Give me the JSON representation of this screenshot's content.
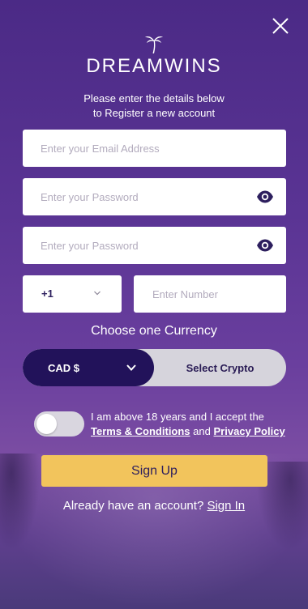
{
  "brand": {
    "logo_text": "DREAMWINS"
  },
  "intro": {
    "line1": "Please enter the details below",
    "line2": "to Register a new account"
  },
  "form": {
    "email_placeholder": "Enter your Email Address",
    "password_placeholder": "Enter your Password",
    "confirm_password_placeholder": "Enter your Password",
    "country_code": "+1",
    "phone_placeholder": "Enter Number"
  },
  "currency": {
    "title": "Choose one Currency",
    "fiat_label": "CAD $",
    "crypto_label": "Select Crypto",
    "selected": "fiat"
  },
  "terms": {
    "prefix": "I am above 18 years and I accept the",
    "terms_link": "Terms & Conditions",
    "and_text": "and",
    "privacy_link": "Privacy Policy",
    "accepted": false
  },
  "actions": {
    "signup_label": "Sign Up"
  },
  "footer": {
    "prompt": "Already have an account?",
    "signin_link": "Sign In"
  },
  "icons": {
    "close": "close-icon",
    "eye": "eye-icon",
    "chevron": "chevron-down-icon",
    "palm": "palm-tree-icon"
  },
  "colors": {
    "background": "#5a3494",
    "primary_dark": "#22125a",
    "accent": "#f2c45c",
    "toggle_off": "#d9d6df"
  }
}
